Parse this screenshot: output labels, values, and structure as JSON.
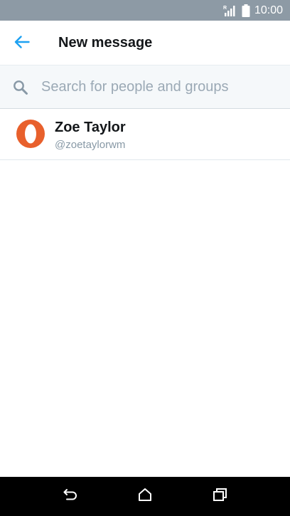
{
  "status_bar": {
    "time": "10:00",
    "signal_icon": "signal-icon",
    "battery_icon": "battery-icon"
  },
  "header": {
    "back_icon": "arrow-left-icon",
    "title": "New message"
  },
  "search": {
    "icon": "search-icon",
    "placeholder": "Search for people and groups",
    "value": ""
  },
  "contacts": [
    {
      "name": "Zoe Taylor",
      "handle": "@zoetaylorwm",
      "avatar_icon": "opera-logo-icon"
    }
  ],
  "nav_bar": {
    "back_icon": "back-icon",
    "home_icon": "home-icon",
    "recents_icon": "recents-icon"
  },
  "colors": {
    "status_bar_bg": "#8d9aa5",
    "accent": "#1da1f2",
    "search_bg": "#f5f8fa",
    "avatar_orange": "#e8602c",
    "nav_bar_bg": "#000000"
  }
}
